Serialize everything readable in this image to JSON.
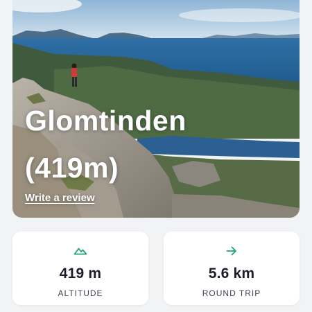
{
  "hero": {
    "title_line1": "Glomtinden",
    "title_line2": "(419m)",
    "review_link": "Write a review",
    "image_icon": "mountain-landscape-photo"
  },
  "stats": [
    {
      "icon": "mountain-icon",
      "value": "419 m",
      "label": "ALTITUDE"
    },
    {
      "icon": "arrow-right-icon",
      "value": "5.6 km",
      "label": "ROUND TRIP"
    }
  ],
  "colors": {
    "accent": "#1fa37a",
    "card_bg": "#ffffff",
    "page_bg": "#f2f3f5",
    "text_dark": "#1b1e25"
  }
}
